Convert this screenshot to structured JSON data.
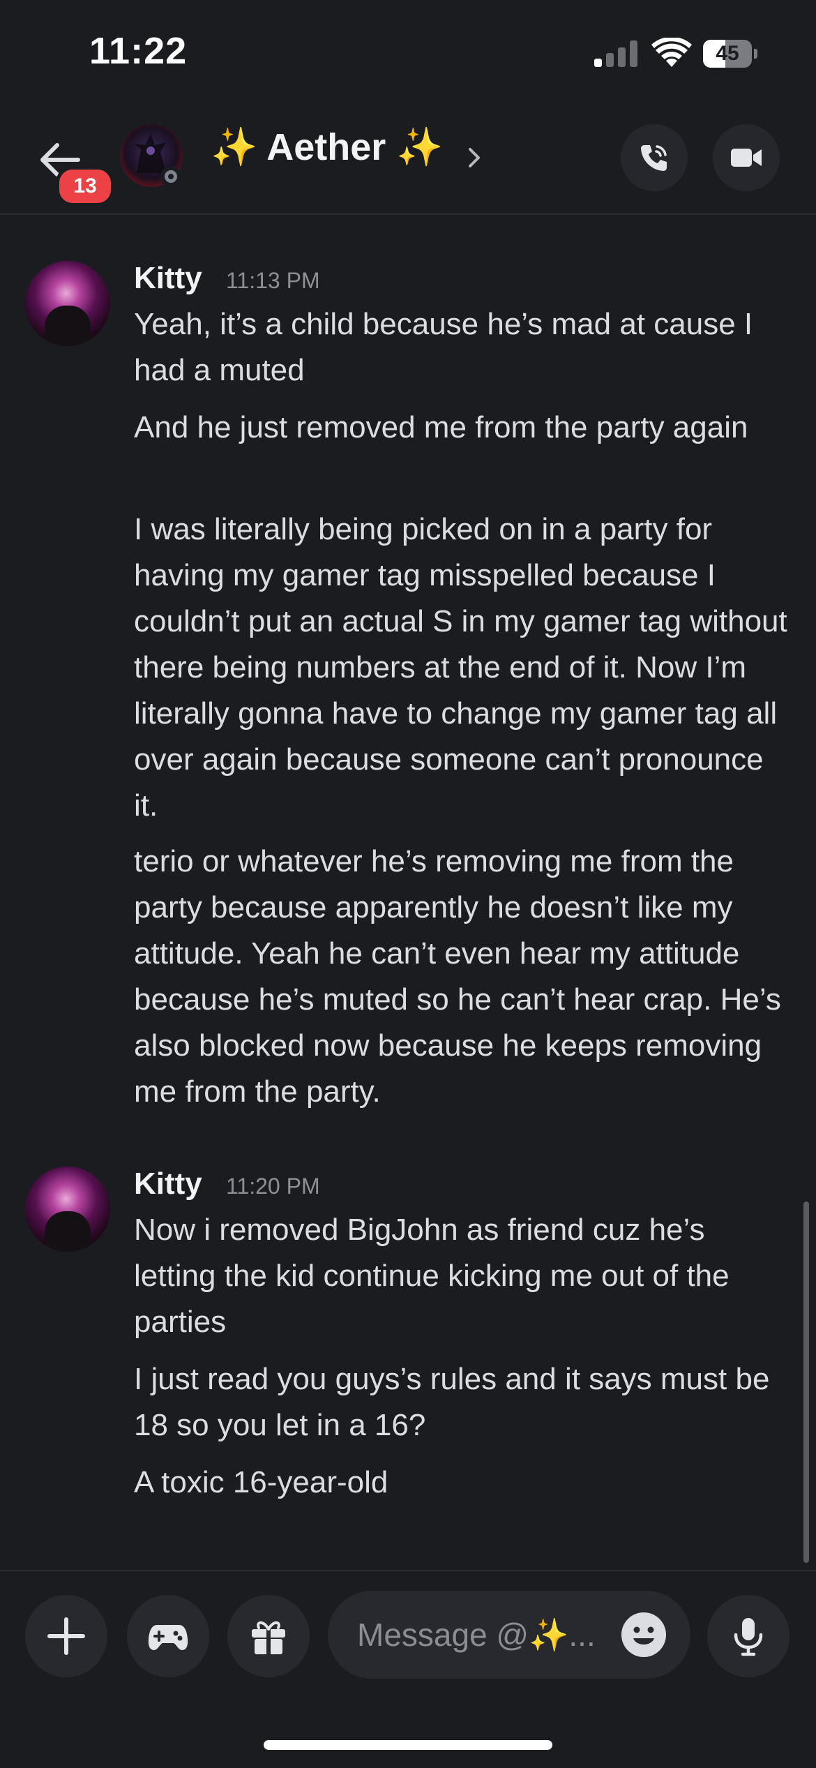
{
  "status_bar": {
    "time": "11:22",
    "battery_percent": "45",
    "battery_level": 0.45,
    "signal_bars_active": 1,
    "signal_bars_total": 4
  },
  "header": {
    "back_icon": "arrow-left-icon",
    "unread_count": "13",
    "title": "✨ Aether ✨",
    "presence": "offline",
    "chevron_icon": "chevron-right-icon",
    "call_icon": "phone-call-icon",
    "video_icon": "video-camera-icon"
  },
  "messages": [
    {
      "author": "Kitty",
      "timestamp": "11:13 PM",
      "lines": [
        "Yeah, it’s a child because he’s mad at cause I had a muted",
        "And he just removed me from the party again",
        "I was literally being picked on in a party for having my gamer tag misspelled because I couldn’t put an actual S in my gamer tag without there being numbers at the end of it. Now I’m literally gonna have to change my gamer tag all over again because someone can’t pronounce it.",
        "terio or whatever he’s removing me from the party because apparently he doesn’t like my attitude. Yeah he can’t even hear my attitude because he’s muted so he can’t hear crap. He’s also blocked now because he keeps removing me from the party."
      ]
    },
    {
      "author": "Kitty",
      "timestamp": "11:20 PM",
      "lines": [
        "Now i removed BigJohn as friend cuz he’s letting the kid continue kicking me out of the parties",
        "I just read you guys’s rules and it says must be 18 so you let in a 16?",
        "A toxic 16-year-old"
      ]
    }
  ],
  "composer": {
    "plus_icon": "plus-icon",
    "game_icon": "gamepad-icon",
    "gift_icon": "gift-icon",
    "placeholder": "Message @✨...",
    "emoji_icon": "emoji-icon",
    "mic_icon": "microphone-icon"
  },
  "colors": {
    "background": "#1b1c20",
    "badge": "#ed4245",
    "button_bg": "#28292e",
    "text": "#dbdee1",
    "muted_text": "#8e9097"
  }
}
